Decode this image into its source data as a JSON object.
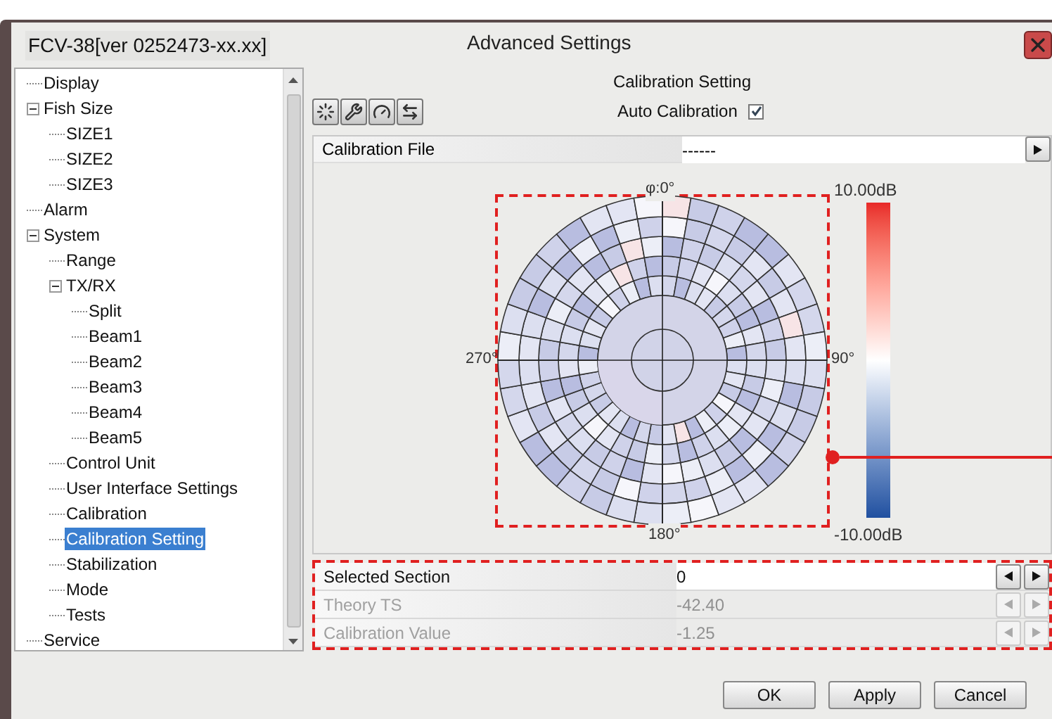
{
  "window": {
    "device": "FCV-38[ver 0252473-xx.xx]",
    "title": "Advanced Settings"
  },
  "tree": [
    {
      "label": "Display",
      "selected": false
    },
    {
      "label": "Fish Size",
      "selected": false,
      "expanded": true,
      "children": [
        {
          "label": "SIZE1",
          "selected": false
        },
        {
          "label": "SIZE2",
          "selected": false
        },
        {
          "label": "SIZE3",
          "selected": false
        }
      ]
    },
    {
      "label": "Alarm",
      "selected": false
    },
    {
      "label": "System",
      "selected": false,
      "expanded": true,
      "children": [
        {
          "label": "Range",
          "selected": false
        },
        {
          "label": "TX/RX",
          "selected": false,
          "expanded": true,
          "children": [
            {
              "label": "Split",
              "selected": false
            },
            {
              "label": "Beam1",
              "selected": false
            },
            {
              "label": "Beam2",
              "selected": false
            },
            {
              "label": "Beam3",
              "selected": false
            },
            {
              "label": "Beam4",
              "selected": false
            },
            {
              "label": "Beam5",
              "selected": false
            }
          ]
        },
        {
          "label": "Control Unit",
          "selected": false
        },
        {
          "label": "User Interface Settings",
          "selected": false
        },
        {
          "label": "Calibration",
          "selected": false
        },
        {
          "label": "Calibration Setting",
          "selected": true
        },
        {
          "label": "Stabilization",
          "selected": false
        },
        {
          "label": "Mode",
          "selected": false
        },
        {
          "label": "Tests",
          "selected": false
        }
      ]
    },
    {
      "label": "Service",
      "selected": false
    }
  ],
  "panel": {
    "title": "Calibration Setting",
    "auto_calibration": {
      "label": "Auto Calibration",
      "checked": true
    },
    "calibration_file": {
      "label": "Calibration File",
      "value": "------"
    }
  },
  "plot": {
    "top_label": "φ:0°",
    "right_label": "90°",
    "bottom_label": "180°",
    "left_label": "270°",
    "scale_max": "10.00dB",
    "scale_min": "-10.00dB"
  },
  "fields": [
    {
      "label": "Selected Section",
      "value": "0",
      "disabled": false
    },
    {
      "label": "Theory TS",
      "value": "-42.40",
      "disabled": true
    },
    {
      "label": "Calibration Value",
      "value": "-1.25",
      "disabled": true
    }
  ],
  "buttons": [
    "OK",
    "Apply",
    "Cancel"
  ]
}
